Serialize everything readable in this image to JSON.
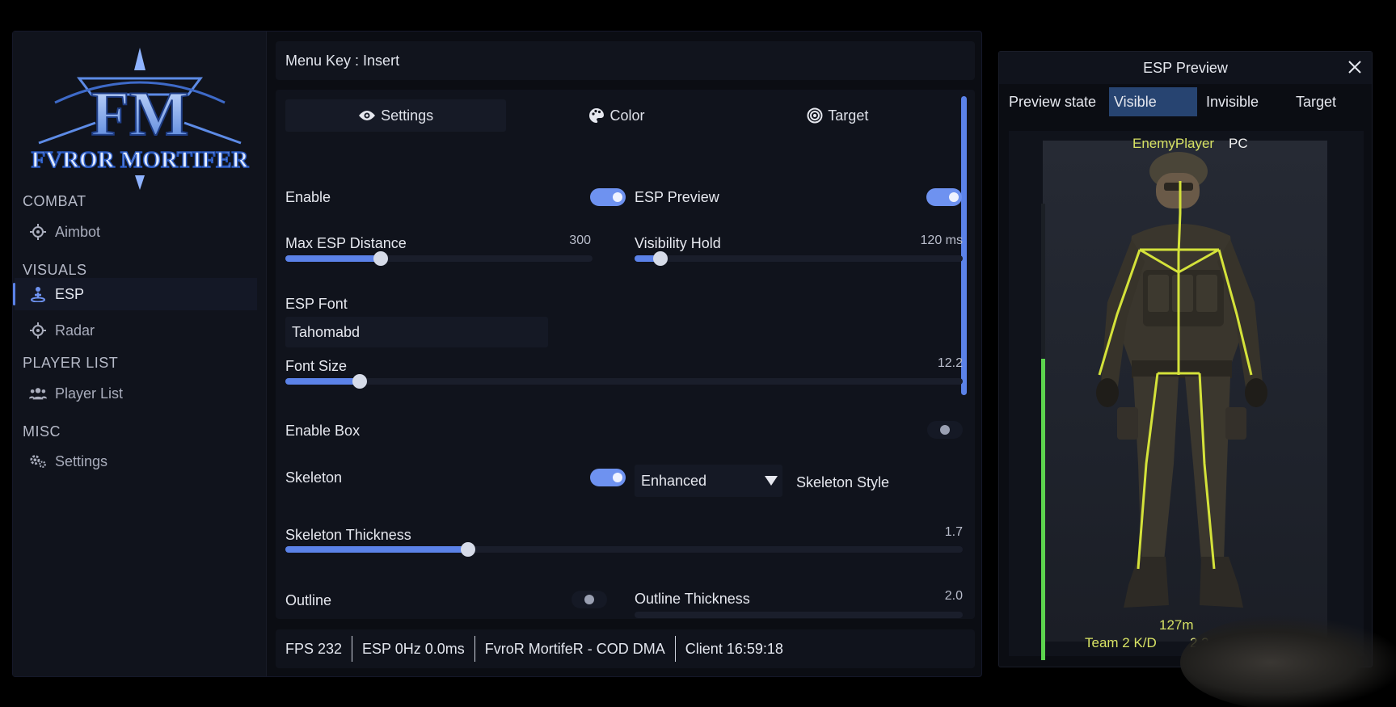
{
  "sidebar": {
    "logo_text": "FVROR MORTIFER",
    "sections": {
      "combat": "COMBAT",
      "visuals": "VISUALS",
      "player_list": "PLAYER LIST",
      "misc": "MISC"
    },
    "items": {
      "aimbot": "Aimbot",
      "esp": "ESP",
      "radar": "Radar",
      "player_list": "Player List",
      "settings": "Settings"
    },
    "active_item": "ESP"
  },
  "header": {
    "menu_key": "Menu Key : Insert"
  },
  "tabs": {
    "settings": "Settings",
    "color": "Color",
    "target": "Target",
    "active": "Settings"
  },
  "esp_settings": {
    "enable": {
      "label": "Enable",
      "on": true
    },
    "esp_preview": {
      "label": "ESP Preview",
      "on": true
    },
    "max_esp_distance": {
      "label": "Max ESP Distance",
      "value": "300",
      "fraction": 0.31
    },
    "visibility_hold": {
      "label": "Visibility Hold",
      "value": "120 ms",
      "fraction": 0.08
    },
    "esp_font": {
      "label": "ESP Font",
      "value": "Tahomabd"
    },
    "font_size": {
      "label": "Font Size",
      "value": "12.2",
      "fraction": 0.11
    },
    "enable_box": {
      "label": "Enable Box",
      "on": false
    },
    "skeleton": {
      "label": "Skeleton",
      "on": true
    },
    "skeleton_style": {
      "label": "Skeleton Style",
      "value": "Enhanced"
    },
    "skeleton_thickness": {
      "label": "Skeleton Thickness",
      "value": "1.7",
      "fraction": 0.27
    },
    "outline": {
      "label": "Outline",
      "on": false
    },
    "outline_thickness": {
      "label": "Outline Thickness",
      "value": "2.0"
    }
  },
  "status_bar": {
    "fps": "FPS 232",
    "esp": "ESP 0Hz 0.0ms",
    "app": "FvroR MortifeR - COD DMA",
    "client": "Client 16:59:18"
  },
  "preview": {
    "title": "ESP Preview",
    "state_label": "Preview state",
    "states": {
      "visible": "Visible",
      "invisible": "Invisible",
      "target": "Target"
    },
    "active_state": "Visible",
    "player_name": "EnemyPlayer",
    "platform": "PC",
    "distance": "127m",
    "team": "Team 2 K/D",
    "kd": "2.3",
    "health_fraction": 0.66,
    "colors": {
      "skeleton": "#d4e23a",
      "health": "#5cd44e",
      "accent": "#5b82e8"
    }
  }
}
